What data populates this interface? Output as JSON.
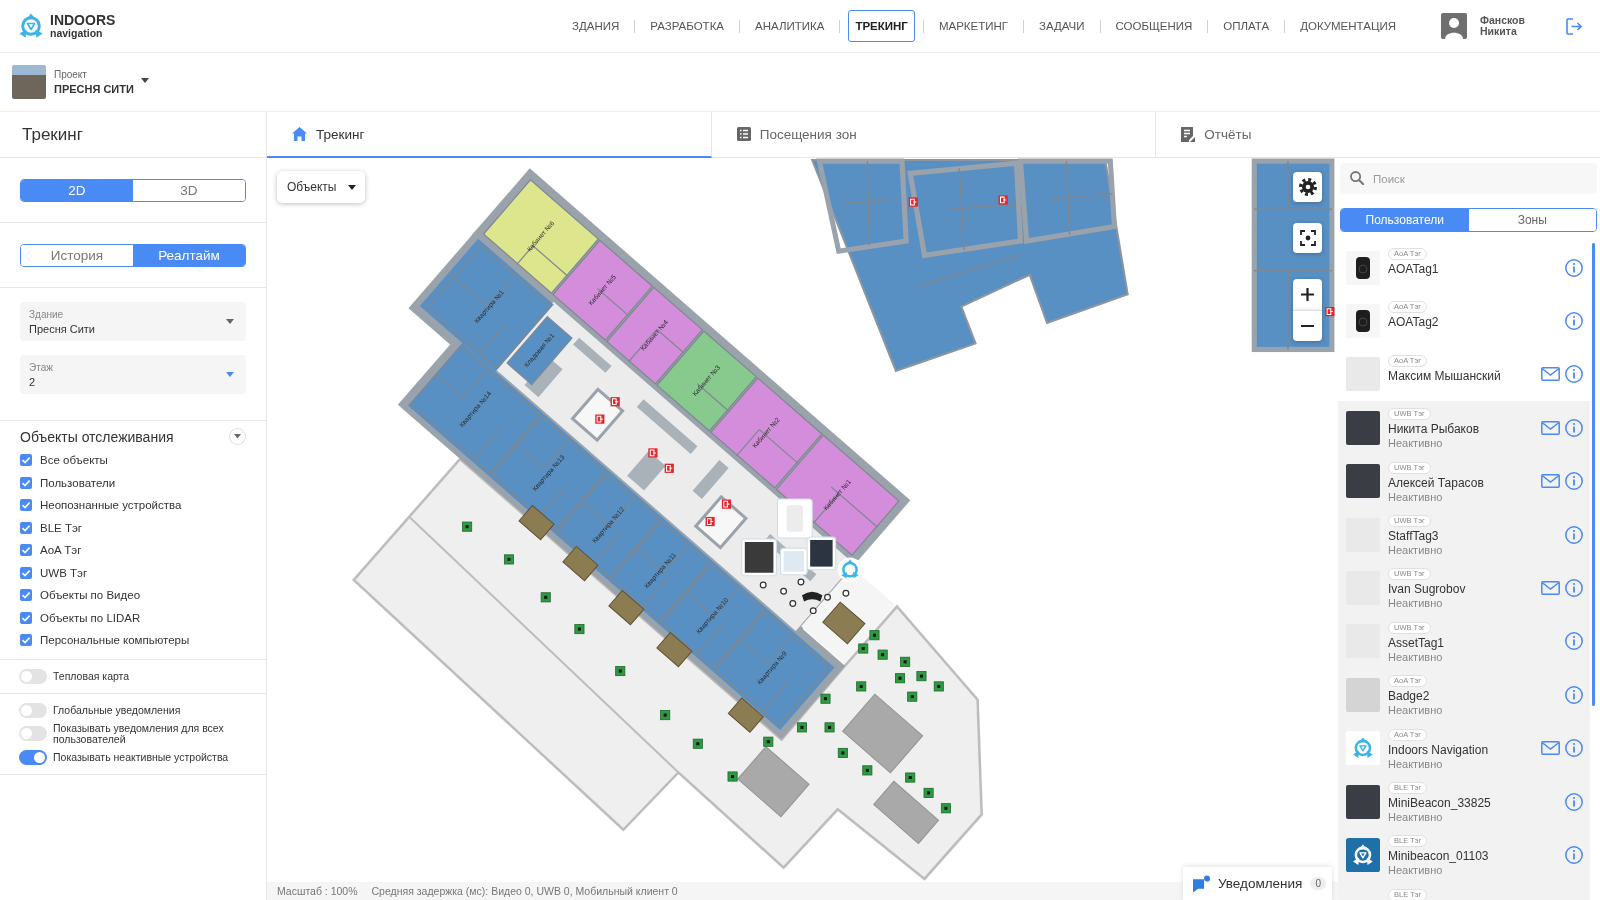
{
  "header": {
    "logo": {
      "title": "INDOORS",
      "subtitle": "navigation"
    },
    "nav": [
      {
        "label": "ЗДАНИЯ",
        "selected": false
      },
      {
        "label": "РАЗРАБОТКА",
        "selected": false
      },
      {
        "label": "АНАЛИТИКА",
        "selected": false
      },
      {
        "label": "ТРЕКИНГ",
        "selected": true
      },
      {
        "label": "МАРКЕТИНГ",
        "selected": false
      },
      {
        "label": "ЗАДАЧИ",
        "selected": false
      },
      {
        "label": "СООБЩЕНИЯ",
        "selected": false
      },
      {
        "label": "ОПЛАТА",
        "selected": false
      },
      {
        "label": "ДОКУМЕНТАЦИЯ",
        "selected": false
      }
    ],
    "user": {
      "name": "Фансков Никита"
    }
  },
  "project": {
    "label": "Проект",
    "name": "ПРЕСНЯ СИТИ"
  },
  "page_tabs": {
    "title": "Трекинг",
    "tabs": [
      {
        "label": "Трекинг",
        "selected": true
      },
      {
        "label": "Посещения зон",
        "selected": false
      },
      {
        "label": "Отчёты",
        "selected": false
      }
    ]
  },
  "sidebar": {
    "view_mode": [
      {
        "label": "2D",
        "selected": true
      },
      {
        "label": "3D",
        "selected": false
      }
    ],
    "time_mode": [
      {
        "label": "История",
        "selected": false
      },
      {
        "label": "Реалтайм",
        "selected": true
      }
    ],
    "selects": [
      {
        "label": "Здание",
        "value": "Пресня Сити",
        "focused": false
      },
      {
        "label": "Этаж",
        "value": "2",
        "focused": true
      }
    ],
    "objects": {
      "title": "Объекты отслеживания",
      "expanded": true,
      "items": [
        {
          "label": "Все объекты",
          "checked": true
        },
        {
          "label": "Пользователи",
          "checked": true
        },
        {
          "label": "Неопознанные устройства",
          "checked": true
        },
        {
          "label": "BLE Тэг",
          "checked": true
        },
        {
          "label": "AoA Тэг",
          "checked": true
        },
        {
          "label": "UWB Тэг",
          "checked": true
        },
        {
          "label": "Объекты по Видео",
          "checked": true
        },
        {
          "label": "Объекты по LIDAR",
          "checked": true
        },
        {
          "label": "Персональные компьютеры",
          "checked": true
        }
      ]
    },
    "heatmap": {
      "label": "Тепловая карта",
      "on": false
    },
    "notification_settings": [
      {
        "label": "Глобальные уведомления",
        "on": false
      },
      {
        "label": "Показывать уведомления для всех пользователей",
        "on": false
      },
      {
        "label": "Показывать неактивные устройства",
        "on": true
      }
    ]
  },
  "map": {
    "objects_filter": {
      "label": "Объекты"
    },
    "floor_plan": {
      "rooms": [
        {
          "label": "Кабинет №6",
          "color": "#dde68c"
        },
        {
          "label": "Кабинет №5",
          "color": "#d48ddb"
        },
        {
          "label": "Кабинет №4",
          "color": "#d48ddb"
        },
        {
          "label": "Кабинет №3",
          "color": "#88c98e"
        },
        {
          "label": "Кабинет №2",
          "color": "#d48ddb"
        },
        {
          "label": "Кабинет №1",
          "color": "#d48ddb"
        },
        {
          "label": "Квартира №1",
          "color": "#5890c4"
        },
        {
          "label": "Кладовая №1",
          "color": "#5890c4"
        },
        {
          "label": "Квартира №14",
          "color": "#5890c4"
        },
        {
          "label": "Квартира №13",
          "color": "#5890c4"
        },
        {
          "label": "Квартира №12",
          "color": "#5890c4"
        },
        {
          "label": "Квартира №11",
          "color": "#5890c4"
        },
        {
          "label": "Квартира №10",
          "color": "#5890c4"
        },
        {
          "label": "Квартира №9",
          "color": "#5890c4"
        }
      ]
    },
    "status": {
      "scale": "Масштаб : 100%",
      "latency": "Средняя задержка (мс): Видео 0, UWB 0, Мобильный клиент 0"
    },
    "notifications": {
      "label": "Уведомления",
      "count": "0"
    }
  },
  "objects_panel": {
    "search": {
      "placeholder": "Поиск"
    },
    "tabs": [
      {
        "label": "Пользователи",
        "selected": true
      },
      {
        "label": "Зоны",
        "selected": false
      }
    ],
    "objects": [
      {
        "type": "AoA Тэг",
        "name": "AOATag1",
        "active": true,
        "mail": false,
        "avatar": {
          "kind": "device"
        }
      },
      {
        "type": "AoA Тэг",
        "name": "AOATag2",
        "active": true,
        "mail": false,
        "avatar": {
          "kind": "device"
        }
      },
      {
        "type": "AoA Тэг",
        "name": "Максим Мышанский",
        "active": true,
        "mail": true,
        "avatar": {
          "kind": "photo-light"
        }
      },
      {
        "type": "UWB Тэг",
        "name": "Никита Рыбаков",
        "status": "Неактивно",
        "active": false,
        "mail": true,
        "avatar": {
          "kind": "photo-dark"
        }
      },
      {
        "type": "UWB Тэг",
        "name": "Алексей Тарасов",
        "status": "Неактивно",
        "active": false,
        "mail": true,
        "avatar": {
          "kind": "photo-dark"
        }
      },
      {
        "type": "UWB Тэг",
        "name": "StaffTag3",
        "status": "Неактивно",
        "active": false,
        "mail": false,
        "avatar": {
          "kind": "photo-light"
        }
      },
      {
        "type": "UWB Тэг",
        "name": "Ivan Sugrobov",
        "status": "Неактивно",
        "active": false,
        "mail": true,
        "avatar": {
          "kind": "photo-light"
        }
      },
      {
        "type": "UWB Тэг",
        "name": "AssetTag1",
        "status": "Неактивно",
        "active": false,
        "mail": false,
        "avatar": {
          "kind": "photo-light"
        }
      },
      {
        "type": "AoA Тэг",
        "name": "Badge2",
        "status": "Неактивно",
        "active": false,
        "mail": false,
        "avatar": {
          "kind": "photo-grey"
        }
      },
      {
        "type": "AoA Тэг",
        "name": "Indoors Navigation",
        "status": "Неактивно",
        "active": false,
        "mail": true,
        "avatar": {
          "kind": "logo"
        }
      },
      {
        "type": "BLE Тэг",
        "name": "MiniBeacon_33825",
        "status": "Неактивно",
        "active": false,
        "mail": false,
        "avatar": {
          "kind": "photo-dark"
        }
      },
      {
        "type": "BLE Тэг",
        "name": "Minibeacon_01103",
        "status": "Неактивно",
        "active": false,
        "mail": false,
        "avatar": {
          "kind": "logo-tile"
        }
      },
      {
        "type": "BLE Тэг",
        "active": false
      }
    ]
  }
}
